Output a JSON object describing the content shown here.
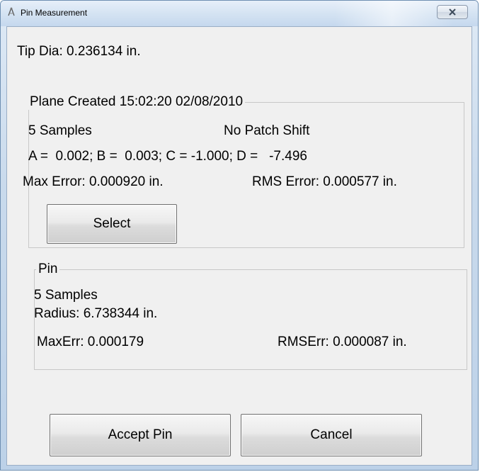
{
  "window": {
    "title": "Pin Measurement",
    "icon": "compass-icon",
    "close_icon": "close-icon"
  },
  "tip_dia": "Tip Dia: 0.236134 in.",
  "plane": {
    "legend": "Plane Created 15:02:20 02/08/2010",
    "samples": "5 Samples",
    "patch_shift": "No Patch Shift",
    "coefficients": "A =  0.002; B =  0.003; C = -1.000; D =   -7.496",
    "max_error": "Max Error: 0.000920 in.",
    "rms_error": "RMS Error: 0.000577 in.",
    "select_label": "Select"
  },
  "pin": {
    "legend": "Pin",
    "samples": "5 Samples",
    "radius": "Radius: 6.738344 in.",
    "max_err": "MaxErr: 0.000179",
    "rms_err": "RMSErr: 0.000087 in."
  },
  "buttons": {
    "accept_label": "Accept Pin",
    "cancel_label": "Cancel"
  },
  "colors": {
    "titlebar": "#d3e2f2",
    "client_bg": "#f0f0f0",
    "group_border": "#c8c8c8"
  }
}
